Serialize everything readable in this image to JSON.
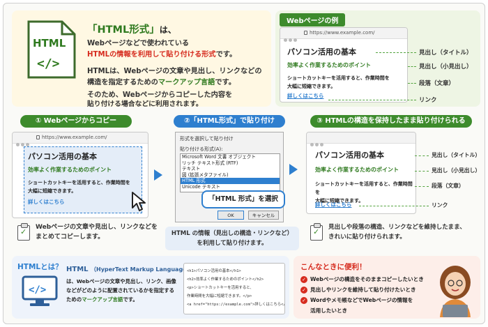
{
  "intro": {
    "heading": "「HTML形式」",
    "heading_suffix": "は、",
    "line1": "Webページなどで使われている",
    "line2_red": "HTMLの情報を利用して貼り付ける形式",
    "line2_end": "です。",
    "line3": "HTMLは、Webページの文章や見出し、リンクなどの",
    "line4_a": "構造を指定するための",
    "line4_green": "マークアップ言語",
    "line4_b": "です。",
    "line5": "そのため、Webページからコピーした内容を",
    "line6": "貼り付ける場合などに利用されます。",
    "icon_text": "HTML",
    "icon_code": "</>"
  },
  "example": {
    "tag": "Webページの例",
    "url": "https://www.example.com/",
    "title": "パソコン活用の基本",
    "subtitle": "効率よく作業するためのポイント",
    "para1": "ショートカットキーを活用すると、作業時間を",
    "para2": "大幅に短縮できます。",
    "link": "詳しくはこちら",
    "labels": [
      "見出し（タイトル）",
      "見出し（小見出し）",
      "段落（文章）",
      "リンク"
    ]
  },
  "steps": {
    "s1": "① Webページからコピー",
    "s2": "②「HTML形式」で貼り付け",
    "s3": "③ HTMLの構造を保持したまま貼り付けられる"
  },
  "step1": {
    "url": "https://www.example.com/",
    "title": "パソコン活用の基本",
    "subtitle": "効率よく作業するためのポイント",
    "para1": "ショートカットキーを活用すると、作業時間を",
    "para2": "大幅に短縮できます。",
    "link": "詳しくはこちら",
    "note1": "Webページの文章や見出し、リンクなどを",
    "note2": "まとめてコピーします。"
  },
  "dialog": {
    "title": "形式を選択して貼り付け",
    "label": "貼り付ける形式(A):",
    "options": [
      "Microsoft Word 文書 オブジェクト",
      "リッチ テキスト形式 (RTF)",
      "テキスト",
      "図 (拡張メタファイル)",
      "HTML 形式",
      "Unicode テキスト"
    ],
    "ok": "OK",
    "cancel": "キャンセル",
    "callout": "「HTML 形式」を選択",
    "note1": "HTML の情報（見出しの構造・リンクなど）",
    "note2": "を利用して貼り付けます。"
  },
  "step3": {
    "title": "パソコン活用の基本",
    "subtitle": "効率よく作業するためのポイント",
    "para1": "ショートカットキーを活用すると、作業時間を",
    "para2": "大幅に短縮できます。",
    "link": "詳しくはこちら",
    "labels": [
      "見出し（タイトル）",
      "見出し（小見出し）",
      "段落（文章）",
      "リンク"
    ],
    "note1": "見出しや段落の構造、リンクなどを維持したまま、",
    "note2": "きれいに貼り付けられます。"
  },
  "what": {
    "q": "HTMLとは？",
    "term": "HTML",
    "term_full": "（HyperText Markup Language）",
    "d1": "は、Webページの文章や見出し、リンク、画像",
    "d2": "などがどのように配置されているかを指定する",
    "d3_a": "ための",
    "d3_green": "マークアップ言語",
    "d3_b": "です。",
    "code": [
      "<h1>パソコン活用の基本</h1>",
      "<h2>効率よく作業するためのポイント</h2>",
      "<p>ショートカットキーを活用すると、",
      "作業時間を大幅に短縮できます。</p>",
      "<a href=\"https://example.com\">詳しくはこちら</a>"
    ]
  },
  "benefits": {
    "title": "こんなときに便利！",
    "items": [
      "Webページの構造をそのままコピーしたいとき",
      "見出しやリンクを維持して貼り付けたいとき",
      "Wordやメモ帳などでWebページの情報を"
    ],
    "item3b": "活用したいとき"
  },
  "colors": {
    "green": "#3d8b2c",
    "blue": "#2e7fcf",
    "red": "#d62b1e"
  }
}
